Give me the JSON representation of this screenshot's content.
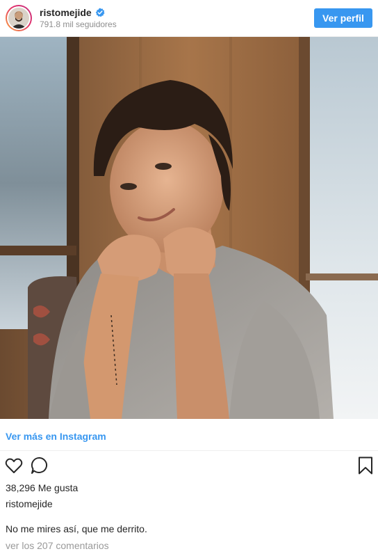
{
  "header": {
    "username": "ristomejide",
    "followers": "791.8 mil seguidores",
    "view_profile_label": "Ver perfil",
    "verified_icon": "verified-badge-icon"
  },
  "post": {
    "more_link": "Ver más en Instagram",
    "likes": "38,296 Me gusta",
    "caption_user": "ristomejide",
    "caption": "No me mires así, que me derrito.",
    "comments_link": "ver los 207 comentarios"
  },
  "icons": {
    "like": "heart-icon",
    "comment": "comment-bubble-icon",
    "save": "bookmark-icon"
  },
  "colors": {
    "accent": "#3897f0",
    "text": "#262626",
    "muted": "#8e8e8e"
  }
}
